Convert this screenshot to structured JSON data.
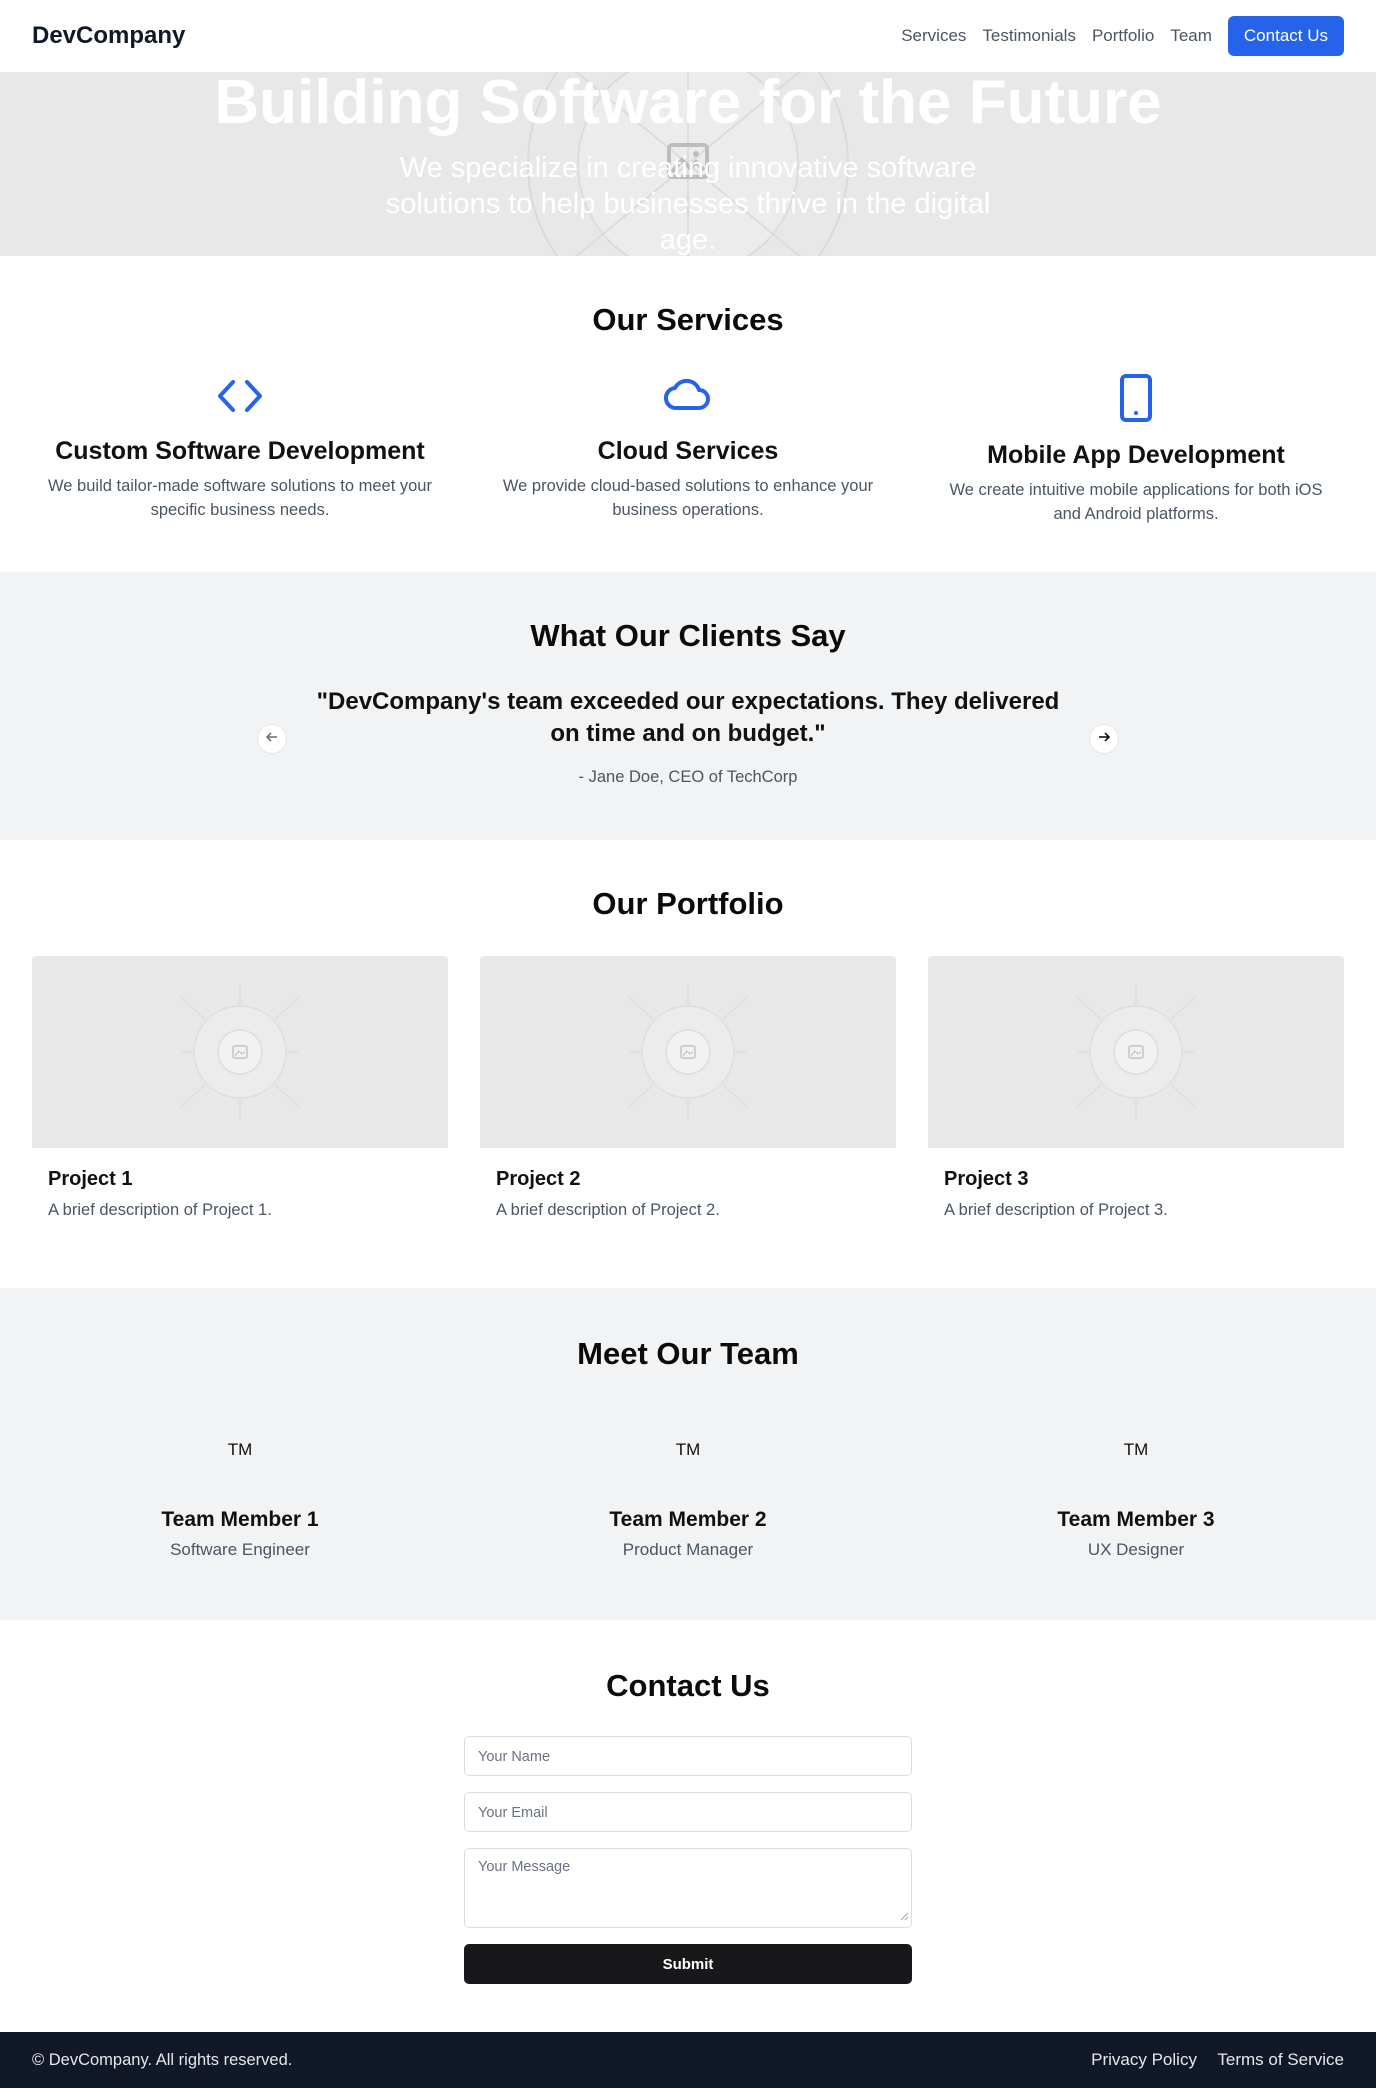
{
  "header": {
    "brand": "DevCompany",
    "nav": [
      "Services",
      "Testimonials",
      "Portfolio",
      "Team"
    ],
    "cta": "Contact Us"
  },
  "hero": {
    "title": "Building Software for the Future",
    "subtitle": "We specialize in creating innovative software solutions to help businesses thrive in the digital age.",
    "image_icon": "image-placeholder-icon"
  },
  "services": {
    "title": "Our Services",
    "items": [
      {
        "icon": "code-icon",
        "title": "Custom Software Development",
        "description": "We build tailor-made software solutions to meet your specific business needs."
      },
      {
        "icon": "cloud-icon",
        "title": "Cloud Services",
        "description": "We provide cloud-based solutions to enhance your business operations."
      },
      {
        "icon": "mobile-icon",
        "title": "Mobile App Development",
        "description": "We create intuitive mobile applications for both iOS and Android platforms."
      }
    ]
  },
  "testimonials": {
    "title": "What Our Clients Say",
    "quote": "\"DevCompany's team exceeded our expectations. They delivered on time and on budget.\"",
    "author": "- Jane Doe, CEO of TechCorp"
  },
  "portfolio": {
    "title": "Our Portfolio",
    "projects": [
      {
        "title": "Project 1",
        "description": "A brief description of Project 1."
      },
      {
        "title": "Project 2",
        "description": "A brief description of Project 2."
      },
      {
        "title": "Project 3",
        "description": "A brief description of Project 3."
      }
    ]
  },
  "team": {
    "title": "Meet Our Team",
    "members": [
      {
        "avatar": "TM",
        "name": "Team Member 1",
        "role": "Software Engineer"
      },
      {
        "avatar": "TM",
        "name": "Team Member 2",
        "role": "Product Manager"
      },
      {
        "avatar": "TM",
        "name": "Team Member 3",
        "role": "UX Designer"
      }
    ]
  },
  "contact": {
    "title": "Contact Us",
    "name_placeholder": "Your Name",
    "email_placeholder": "Your Email",
    "message_placeholder": "Your Message",
    "submit": "Submit"
  },
  "footer": {
    "copyright": "© DevCompany. All rights reserved.",
    "links": [
      "Privacy Policy",
      "Terms of Service"
    ]
  },
  "colors": {
    "accent": "#2563eb",
    "footer_bg": "#111827",
    "section_alt_bg": "#f2f3f4",
    "placeholder_bg": "#e8e8e8"
  }
}
